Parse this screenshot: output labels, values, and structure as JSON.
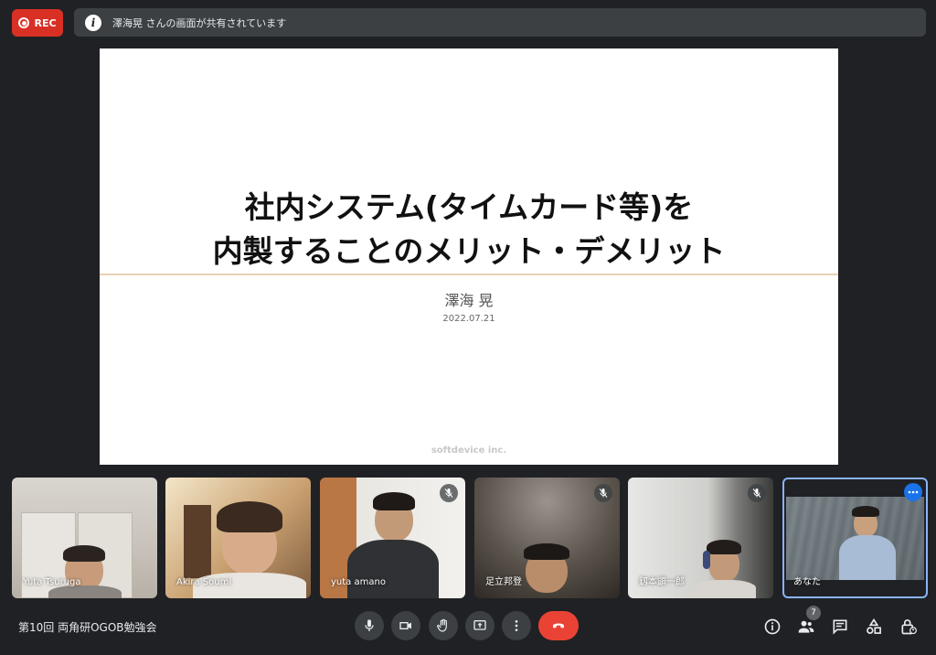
{
  "recording": {
    "label": "REC"
  },
  "banner": {
    "info_glyph": "i",
    "message": "澤海晃 さんの画面が共有されています"
  },
  "slide": {
    "title_line1": "社内システム(タイムカード等)を",
    "title_line2": "内製することのメリット・デメリット",
    "author": "澤海 晃",
    "date": "2022.07.21",
    "footer": "softdevice inc."
  },
  "participants": [
    {
      "name": "Yuta Tsuruga",
      "muted": false
    },
    {
      "name": "Akira Soumi",
      "muted": false
    },
    {
      "name": "yuta amano",
      "muted": true
    },
    {
      "name": "足立邦登",
      "muted": true
    },
    {
      "name": "釼本顕一郎",
      "muted": true
    },
    {
      "name": "あなた",
      "muted": false,
      "self": true
    }
  ],
  "footer": {
    "meeting_title": "第10回 両角研OGOB勉強会",
    "people_count": "7"
  },
  "colors": {
    "accent": "#8ab4f8",
    "end_call": "#ea4335",
    "rec": "#d93025",
    "background": "#202124"
  }
}
